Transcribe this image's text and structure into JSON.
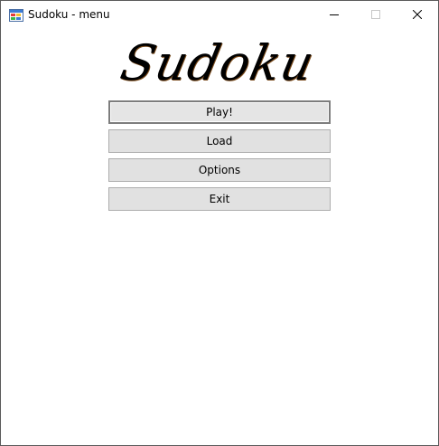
{
  "window": {
    "title": "Sudoku - menu",
    "icon": "windows-forms-app-icon",
    "controls": {
      "minimize": "minimize-icon",
      "maximize": "maximize-icon",
      "close": "close-icon"
    }
  },
  "logo": {
    "text": "Sudoku"
  },
  "menu": {
    "play_label": "Play!",
    "load_label": "Load",
    "options_label": "Options",
    "exit_label": "Exit"
  }
}
